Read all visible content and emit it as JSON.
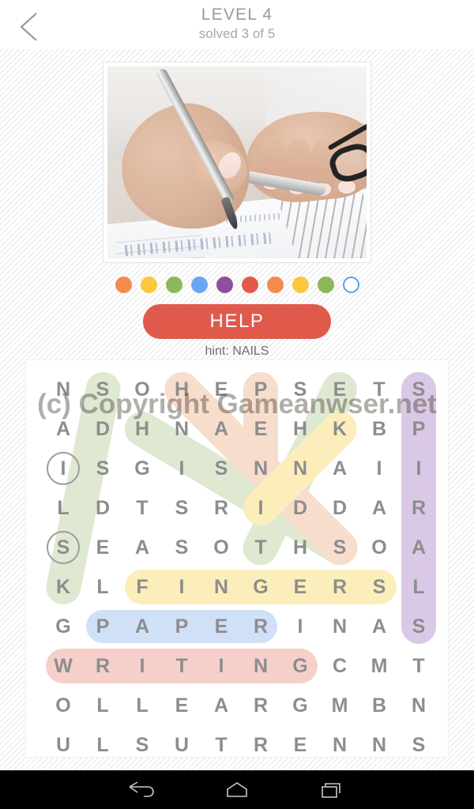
{
  "header": {
    "back_icon": "chevron-left-icon",
    "level_title": "LEVEL 4",
    "solved_status": "solved 3 of 5"
  },
  "picture": {
    "alt": "hands writing with a fountain pen in a spiral notebook next to eyeglasses"
  },
  "progress": {
    "dots": [
      {
        "state": "solved",
        "color": "#f58a4f"
      },
      {
        "state": "solved",
        "color": "#fbc73f"
      },
      {
        "state": "solved",
        "color": "#8cb85c"
      },
      {
        "state": "solved",
        "color": "#6da6f0"
      },
      {
        "state": "solved",
        "color": "#8e4fa0"
      },
      {
        "state": "solved",
        "color": "#e05a4b"
      },
      {
        "state": "solved",
        "color": "#f58a4f"
      },
      {
        "state": "solved",
        "color": "#fbc73f"
      },
      {
        "state": "solved",
        "color": "#8cb85c"
      },
      {
        "state": "current",
        "color": "#ffffff"
      }
    ],
    "current_ring_color": "#5b9bf0"
  },
  "help": {
    "label": "HELP",
    "color": "#e05a4b"
  },
  "hint": {
    "text": "hint: NAILS"
  },
  "grid": {
    "rows": 10,
    "cols": 10,
    "letters": [
      [
        "N",
        "S",
        "O",
        "H",
        "E",
        "P",
        "S",
        "E",
        "T",
        "S"
      ],
      [
        "A",
        "D",
        "H",
        "N",
        "A",
        "E",
        "H",
        "K",
        "B",
        "P"
      ],
      [
        "I",
        "S",
        "G",
        "I",
        "S",
        "N",
        "N",
        "A",
        "I",
        "I"
      ],
      [
        "L",
        "D",
        "T",
        "S",
        "R",
        "I",
        "D",
        "D",
        "A",
        "R"
      ],
      [
        "S",
        "E",
        "A",
        "S",
        "O",
        "T",
        "H",
        "S",
        "O",
        "A"
      ],
      [
        "K",
        "L",
        "F",
        "I",
        "N",
        "G",
        "E",
        "R",
        "S",
        "L"
      ],
      [
        "G",
        "P",
        "A",
        "P",
        "E",
        "R",
        "I",
        "N",
        "A",
        "S"
      ],
      [
        "W",
        "R",
        "I",
        "T",
        "I",
        "N",
        "G",
        "C",
        "M",
        "T"
      ],
      [
        "O",
        "L",
        "L",
        "E",
        "A",
        "R",
        "G",
        "M",
        "B",
        "N"
      ],
      [
        "U",
        "L",
        "S",
        "U",
        "T",
        "R",
        "E",
        "N",
        "N",
        "S"
      ]
    ],
    "revealed_letters": [
      {
        "row": 2,
        "col": 0,
        "letter": "I"
      },
      {
        "row": 4,
        "col": 0,
        "letter": "S"
      }
    ],
    "found_words": [
      {
        "word": "SPIRALS",
        "color": "#d9c9e6",
        "orientation": "vertical"
      },
      {
        "word": "FINGERS",
        "color": "#fbeeba",
        "orientation": "horizontal"
      },
      {
        "word": "PAPER",
        "color": "#cfe0f7",
        "orientation": "horizontal"
      },
      {
        "word": "WRITING",
        "color": "#f6cfcb",
        "orientation": "horizontal"
      },
      {
        "word": "HANDS",
        "color": "#f7ddcc",
        "orientation": "diagonal-down-right"
      },
      {
        "word": "PEN",
        "color": "#f7ddcc",
        "orientation": "vertical"
      },
      {
        "word": "SIGNATURE",
        "color": "#dfe9d2",
        "orientation": "diagonal-down-left"
      },
      {
        "word": "NOTES",
        "color": "#dfe9d2",
        "orientation": "diagonal-down-right"
      },
      {
        "word": "INK",
        "color": "#fbeeba",
        "orientation": "diagonal-up-right"
      }
    ]
  },
  "watermark": {
    "text": "(c) Copyright Gameanwser.net"
  },
  "navbar": {
    "back_icon": "nav-back-icon",
    "home_icon": "nav-home-icon",
    "recent_icon": "nav-recent-icon"
  }
}
